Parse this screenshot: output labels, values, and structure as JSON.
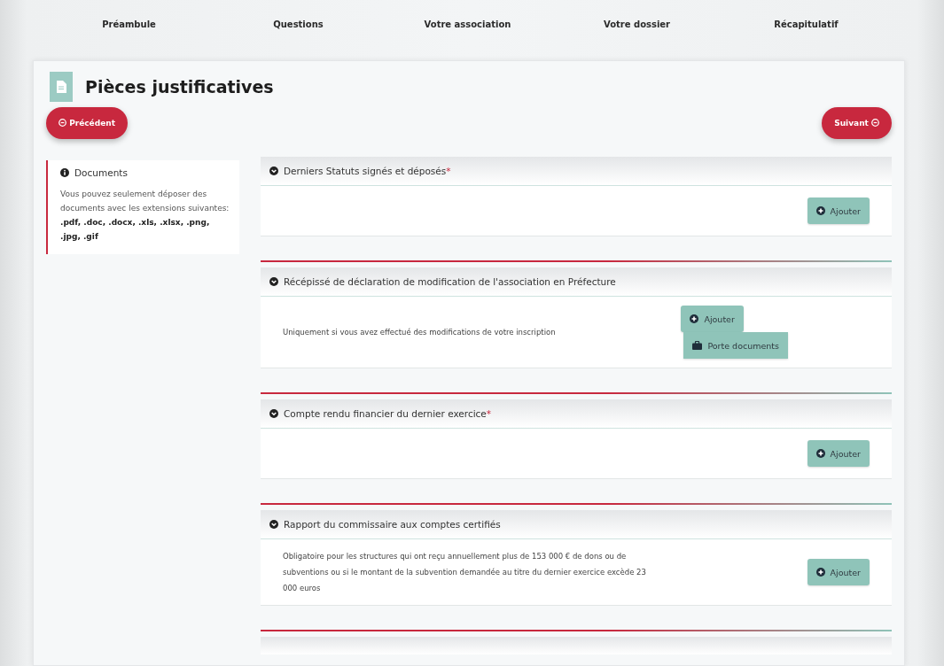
{
  "steps": [
    {
      "label": "Préambule"
    },
    {
      "label": "Questions"
    },
    {
      "label": "Votre association"
    },
    {
      "label": "Votre dossier"
    },
    {
      "label": "Récapitulatif"
    }
  ],
  "page": {
    "title": "Pièces justificatives",
    "previous_button": "Précédent",
    "next_button": "Suivant"
  },
  "info_panel": {
    "title": "Documents",
    "text": "Vous pouvez seulement déposer des documents avec les extensions suivantes:",
    "extensions": ".pdf, .doc, .docx, .xls, .xlsx, .png, .jpg, .gif"
  },
  "sections": [
    {
      "title": "Derniers Statuts signés et déposés",
      "required_mark": "*",
      "buttons": [
        {
          "kind": "add",
          "label": "Ajouter"
        }
      ]
    },
    {
      "title": "Récépissé de déclaration de modification de l'association en Préfecture",
      "description": "Uniquement si vous avez effectué des modifications de votre inscription",
      "buttons": [
        {
          "kind": "add",
          "label": "Ajouter"
        },
        {
          "kind": "briefcase",
          "label": "Porte documents"
        }
      ]
    },
    {
      "title": "Compte rendu financier du dernier exercice",
      "required_mark": "*",
      "buttons": [
        {
          "kind": "add",
          "label": "Ajouter"
        }
      ]
    },
    {
      "title": "Rapport du commissaire aux comptes certifiés",
      "description": "Obligatoire pour les structures qui ont reçu annuellement plus de 153 000 € de dons ou de subventions ou si le montant de la subvention demandée au titre du dernier exercice excède 23 000 euros",
      "buttons": [
        {
          "kind": "add",
          "label": "Ajouter"
        }
      ]
    }
  ]
}
